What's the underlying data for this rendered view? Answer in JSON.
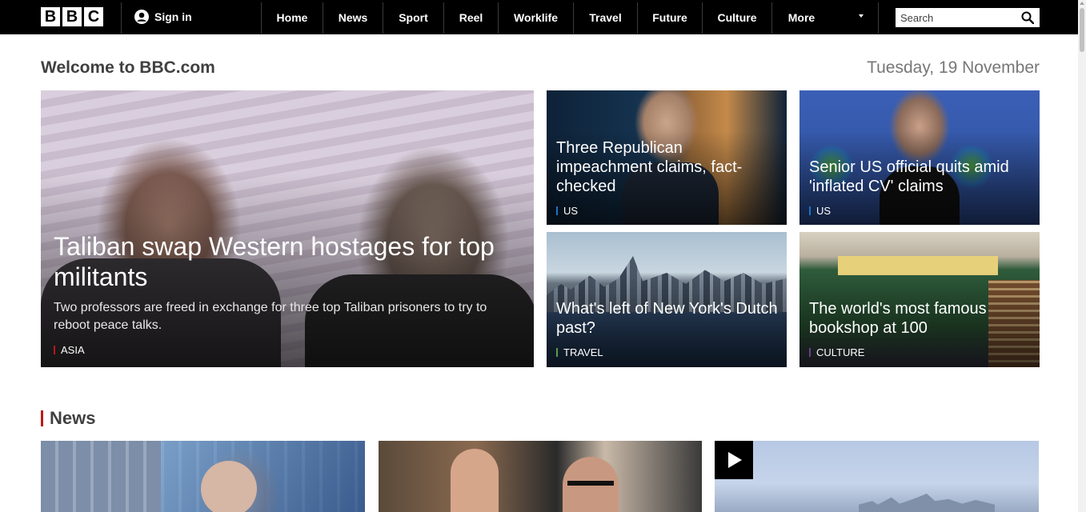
{
  "brand": {
    "logo_letters": [
      "B",
      "B",
      "C"
    ]
  },
  "header": {
    "signin_label": "Sign in",
    "search_placeholder": "Search",
    "nav": [
      {
        "label": "Home"
      },
      {
        "label": "News"
      },
      {
        "label": "Sport"
      },
      {
        "label": "Reel"
      },
      {
        "label": "Worklife"
      },
      {
        "label": "Travel"
      },
      {
        "label": "Future"
      },
      {
        "label": "Culture"
      },
      {
        "label": "More"
      }
    ]
  },
  "page": {
    "welcome": "Welcome to BBC.com",
    "date": "Tuesday, 19 November"
  },
  "hero": {
    "title": "Taliban swap Western hostages for top militants",
    "summary": "Two professors are freed in exchange for three top Taliban prisoners to try to reboot peace talks.",
    "tag": "ASIA",
    "tag_color": "#bb1919"
  },
  "stories": [
    {
      "title": "Three Republican impeachment claims, fact-checked",
      "tag": "US",
      "tag_color": "#1a73c9"
    },
    {
      "title": "Senior US official quits amid 'inflated CV' claims",
      "tag": "US",
      "tag_color": "#1a73c9"
    },
    {
      "title": "What's left of New York's Dutch past?",
      "tag": "TRAVEL",
      "tag_color": "#589e50"
    },
    {
      "title": "The world's most famous bookshop at 100",
      "tag": "CULTURE",
      "tag_color": "#6a3f8a"
    }
  ],
  "news_section": {
    "title": "News",
    "accent_color": "#bb1919"
  },
  "icons": {
    "signin": "user-circle-icon",
    "more": "chevron-down-icon",
    "search": "search-icon",
    "play": "play-icon"
  }
}
